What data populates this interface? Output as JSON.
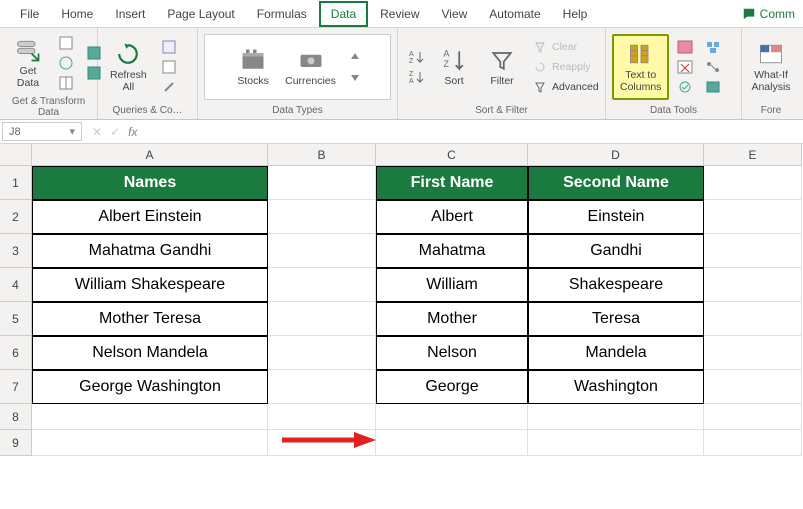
{
  "tabs": [
    "File",
    "Home",
    "Insert",
    "Page Layout",
    "Formulas",
    "Data",
    "Review",
    "View",
    "Automate",
    "Help"
  ],
  "active_tab": "Data",
  "comments_label": "Comm",
  "ribbon": {
    "get_data": "Get\nData",
    "group1": "Get & Transform Data",
    "refresh_all": "Refresh\nAll",
    "group2": "Queries & Co…",
    "stocks": "Stocks",
    "currencies": "Currencies",
    "group3": "Data Types",
    "sort": "Sort",
    "filter": "Filter",
    "clear": "Clear",
    "reapply": "Reapply",
    "advanced": "Advanced",
    "group4": "Sort & Filter",
    "text_to_columns": "Text to\nColumns",
    "group5": "Data Tools",
    "whatif": "What-If\nAnalysis",
    "group6": "Fore"
  },
  "namebox": "J8",
  "fx_label": "fx",
  "columns": [
    "A",
    "B",
    "C",
    "D",
    "E"
  ],
  "row_numbers": [
    "1",
    "2",
    "3",
    "4",
    "5",
    "6",
    "7",
    "8",
    "9"
  ],
  "headers": {
    "names": "Names",
    "first": "First Name",
    "second": "Second Name"
  },
  "data": [
    {
      "full": "Albert Einstein",
      "first": "Albert",
      "second": "Einstein"
    },
    {
      "full": "Mahatma Gandhi",
      "first": "Mahatma",
      "second": "Gandhi"
    },
    {
      "full": "William Shakespeare",
      "first": "William",
      "second": "Shakespeare"
    },
    {
      "full": "Mother Teresa",
      "first": "Mother",
      "second": "Teresa"
    },
    {
      "full": "Nelson Mandela",
      "first": "Nelson",
      "second": "Mandela"
    },
    {
      "full": "George Washington",
      "first": "George",
      "second": "Washington"
    }
  ]
}
